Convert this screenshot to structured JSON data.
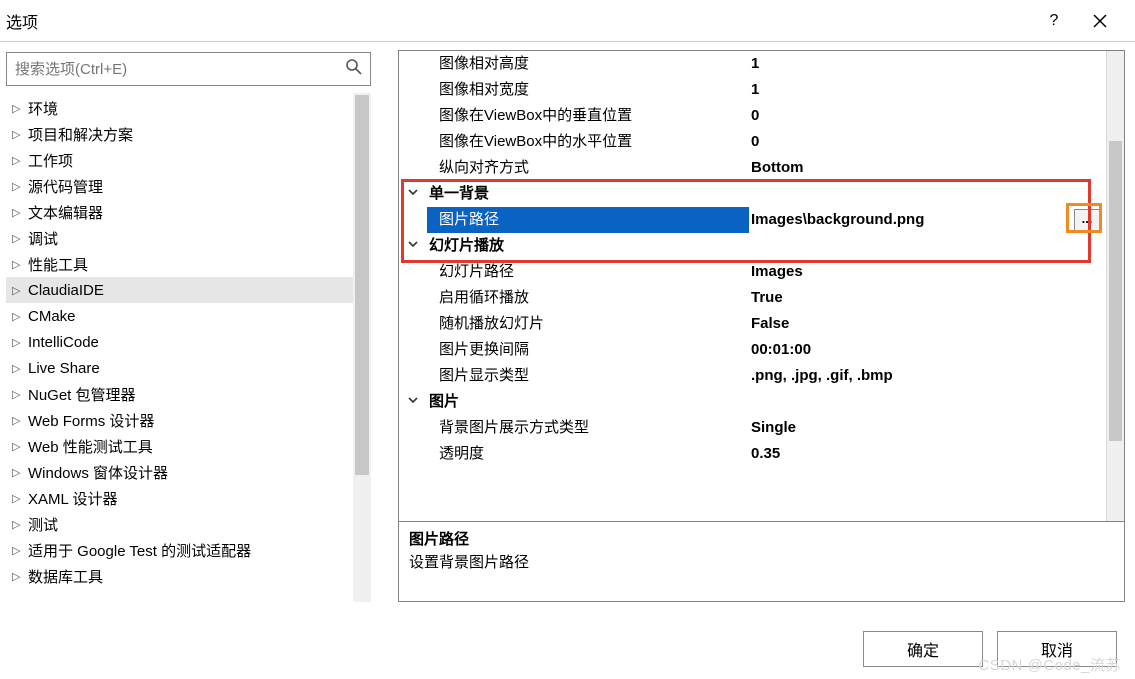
{
  "window": {
    "title": "选项"
  },
  "search": {
    "placeholder": "搜索选项(Ctrl+E)"
  },
  "tree": {
    "items": [
      {
        "label": "环境",
        "selected": false
      },
      {
        "label": "项目和解决方案",
        "selected": false
      },
      {
        "label": "工作项",
        "selected": false
      },
      {
        "label": "源代码管理",
        "selected": false
      },
      {
        "label": "文本编辑器",
        "selected": false
      },
      {
        "label": "调试",
        "selected": false
      },
      {
        "label": "性能工具",
        "selected": false
      },
      {
        "label": "ClaudiaIDE",
        "selected": true
      },
      {
        "label": "CMake",
        "selected": false
      },
      {
        "label": "IntelliCode",
        "selected": false
      },
      {
        "label": "Live Share",
        "selected": false
      },
      {
        "label": "NuGet 包管理器",
        "selected": false
      },
      {
        "label": "Web Forms 设计器",
        "selected": false
      },
      {
        "label": "Web 性能测试工具",
        "selected": false
      },
      {
        "label": "Windows 窗体设计器",
        "selected": false
      },
      {
        "label": "XAML 设计器",
        "selected": false
      },
      {
        "label": "测试",
        "selected": false
      },
      {
        "label": "适用于 Google Test 的测试适配器",
        "selected": false
      },
      {
        "label": "数据库工具",
        "selected": false
      }
    ]
  },
  "grid": {
    "top_rows": [
      {
        "label": "图像相对高度",
        "value": "1"
      },
      {
        "label": "图像相对宽度",
        "value": "1"
      },
      {
        "label": "图像在ViewBox中的垂直位置",
        "value": "0"
      },
      {
        "label": "图像在ViewBox中的水平位置",
        "value": "0"
      },
      {
        "label": "纵向对齐方式",
        "value": "Bottom"
      }
    ],
    "cat_single_bg": "单一背景",
    "image_path_label": "图片路径",
    "image_path_value": "Images\\background.png",
    "cat_slideshow": "幻灯片播放",
    "slideshow_rows": [
      {
        "label": "幻灯片路径",
        "value": "Images"
      },
      {
        "label": "启用循环播放",
        "value": "True"
      },
      {
        "label": "随机播放幻灯片",
        "value": "False"
      },
      {
        "label": "图片更换间隔",
        "value": "00:01:00"
      },
      {
        "label": "图片显示类型",
        "value": ".png, .jpg, .gif, .bmp"
      }
    ],
    "cat_image": "图片",
    "image_rows": [
      {
        "label": "背景图片展示方式类型",
        "value": "Single"
      },
      {
        "label": "透明度",
        "value": "0.35"
      }
    ]
  },
  "description": {
    "title": "图片路径",
    "text": "设置背景图片路径"
  },
  "buttons": {
    "ok": "确定",
    "cancel": "取消"
  },
  "browse_btn": "...",
  "watermark": "CSDN @Code_流苏"
}
